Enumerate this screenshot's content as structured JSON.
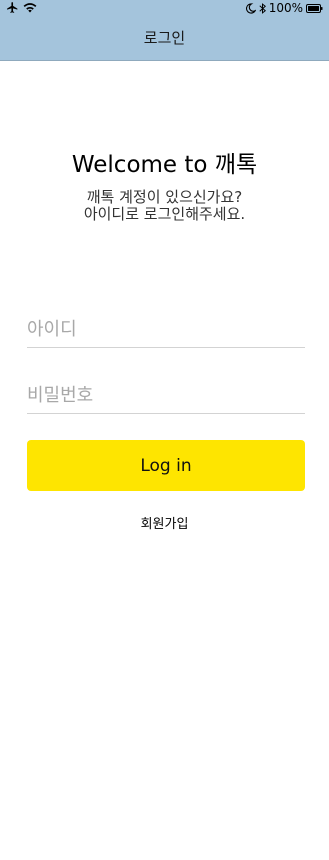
{
  "status_bar": {
    "left_icons": [
      "airplane-icon",
      "wifi-icon"
    ],
    "right_icons": [
      "moon-icon",
      "bluetooth-icon",
      "battery-icon"
    ],
    "battery_percent": "100%"
  },
  "nav": {
    "title": "로그인"
  },
  "welcome": {
    "title": "Welcome to 깨톡",
    "subtitle_line1": "깨톡 계정이 있으신가요?",
    "subtitle_line2": "아이디로 로그인해주세요."
  },
  "form": {
    "id_placeholder": "아이디",
    "id_value": "",
    "password_placeholder": "비밀번호",
    "password_value": "",
    "login_label": "Log in",
    "signup_label": "회원가입"
  },
  "colors": {
    "header_bg": "#a4c4dc",
    "button_bg": "#fee500",
    "divider": "#d3d3d3"
  }
}
